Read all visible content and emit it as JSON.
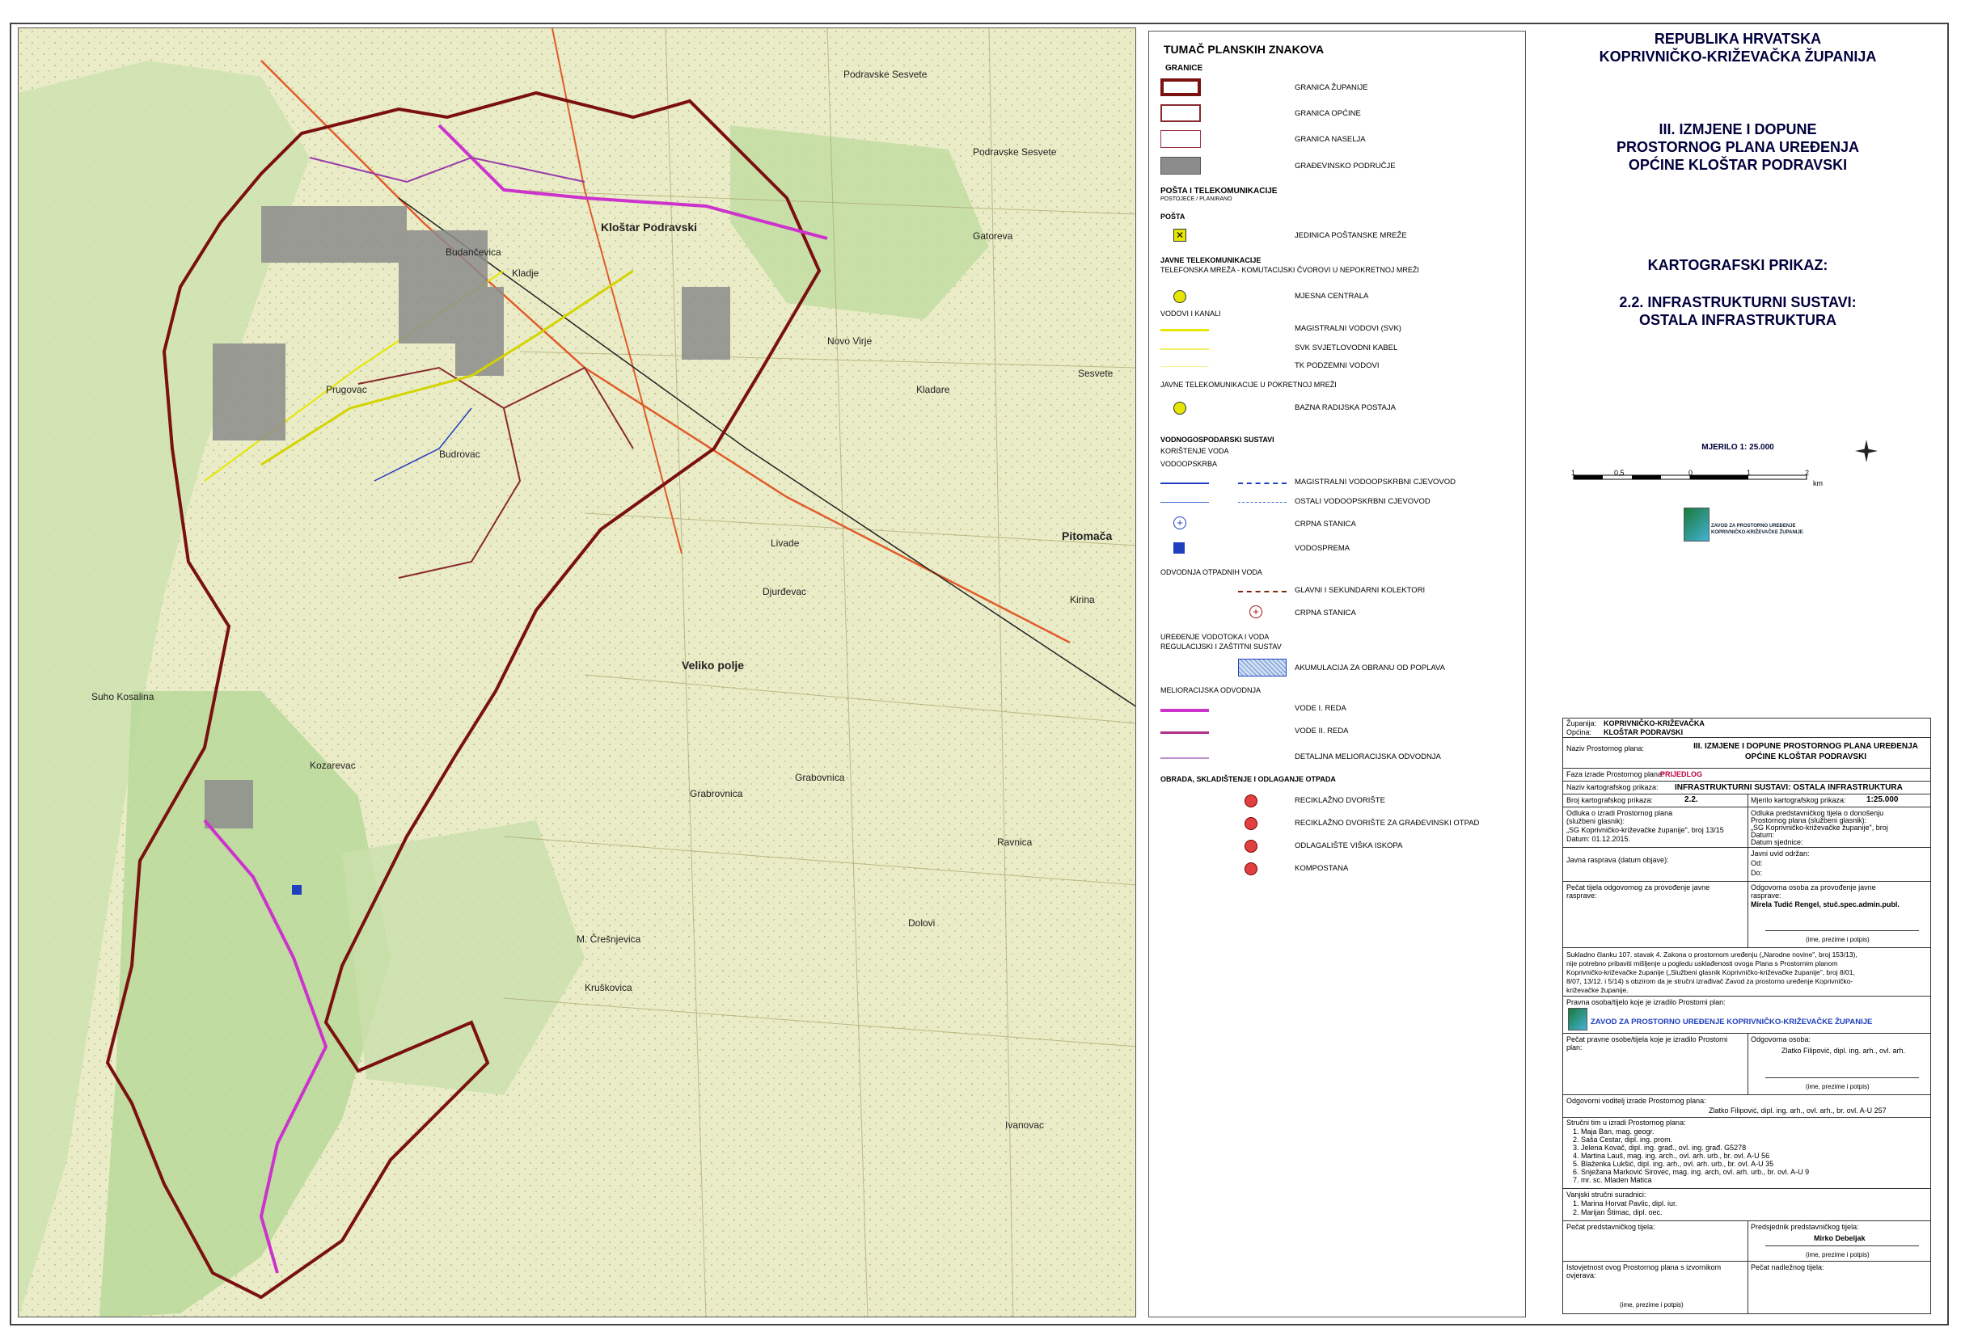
{
  "map": {
    "labels": [
      "Podravske Sesvete",
      "Kloštar Podravski",
      "Budančevica",
      "Prugovac",
      "Kozarevac",
      "Podravske Sesvete",
      "Kladare",
      "Pitomača",
      "Kladje",
      "Veliko polje",
      "Novo Virje",
      "Grabovnica",
      "Grabrovnica",
      "Budrovac",
      "Suho Kosalina",
      "M. Črešnjevica",
      "Kruškovica",
      "Ivanovac",
      "Sesvete",
      "Ravnica",
      "Livade",
      "Djurđevac",
      "Gatoreva",
      "Kirina",
      "Dolovi"
    ],
    "colors": {
      "county_border": "#7a1010",
      "municipality_border": "#8a2a30",
      "settlement_border": "#a03040",
      "ditch_first": "#cc33cc",
      "ditch_second": "#9a3aaa",
      "svk": "#e6e600",
      "water": "#1f3fbf",
      "built_area": "#8c8c8c"
    }
  },
  "legend": {
    "title": "TUMAČ PLANSKIH ZNAKOVA",
    "granice": {
      "heading": "GRANICE",
      "items": [
        "GRANICA ŽUPANIJE",
        "GRANICA OPĆINE",
        "GRANICA NASELJA",
        "GRAĐEVINSKO PODRUČJE"
      ]
    },
    "posta": {
      "heading": "POŠTA I TELEKOMUNIKACIJE",
      "sub": "POSTOJEĆE  /  PLANIRANO",
      "posta_h": "POŠTA",
      "jedinica": "JEDINICA POŠTANSKE MREŽE",
      "javne_h": "JAVNE TELEKOMUNIKACIJE",
      "tel_h": "TELEFONSKA MREŽA - KOMUTACIJSKI ČVOROVI U NEPOKRETNOJ MREŽI",
      "centrala": "MJESNA CENTRALA",
      "vodovi_h": "VODOVI I KANALI",
      "svk": "MAGISTRALNI VODOVI (SVK)",
      "kabel": "SVK SVJETLOVODNI KABEL",
      "tk": "TK PODZEMNI VODOVI",
      "pokretna_h": "JAVNE TELEKOMUNIKACIJE U POKRETNOJ MREŽI",
      "bazna": "BAZNA RADIJSKA POSTAJA"
    },
    "vodno": {
      "heading": "VODNOGOSPODARSKI SUSTAVI",
      "kor": "KORIŠTENJE VODA",
      "opskrba": "VODOOPSKRBA",
      "magistralni": "MAGISTRALNI VODOOPSKRBNI CJEVOVOD",
      "ostali": "OSTALI VODOOPSKRBNI CJEVOVOD",
      "crpna": "CRPNA STANICA",
      "vodosprema": "VODOSPREMA",
      "odvodnja_h": "ODVODNJA OTPADNIH VODA",
      "kolektori": "GLAVNI I SEKUNDARNI KOLEKTORI",
      "crpna2": "CRPNA STANICA",
      "uredenje_h": "UREĐENJE VODOTOKA I VODA",
      "regul_h": "REGULACIJSKI I ZAŠTITNI SUSTAV",
      "akumulacija": "AKUMULACIJA ZA OBRANU OD POPLAVA",
      "melior_h": "MELIORACIJSKA ODVODNJA",
      "vode1": "VODE I. REDA",
      "vode2": "VODE II. REDA",
      "detaljna": "DETALJNA MELIORACIJSKA ODVODNJA"
    },
    "otpad": {
      "heading": "OBRADA, SKLADIŠTENJE I ODLAGANJE OTPADA",
      "items": [
        "RECIKLAŽNO DVORIŠTE",
        "RECIKLAŽNO DVORIŠTE ZA GRAĐEVINSKI OTPAD",
        "ODLAGALIŠTE VIŠKA ISKOPA",
        "KOMPOSTANA"
      ]
    }
  },
  "titles": {
    "republic": "REPUBLIKA HRVATSKA",
    "county": "KOPRIVNIČKO-KRIŽEVAČKA ŽUPANIJA",
    "plan1": "III. IZMJENE I DOPUNE",
    "plan2": "PROSTORNOG PLANA UREĐENJA",
    "plan3": "OPĆINE KLOŠTAR PODRAVSKI",
    "kart": "KARTOGRAFSKI PRIKAZ:",
    "sub1": "2.2. INFRASTRUKTURNI SUSTAVI:",
    "sub2": "OSTALA INFRASTRUKTURA",
    "scale": "MJERILO 1: 25.000",
    "scale_ticks": [
      "1",
      "0,5",
      "0",
      "1",
      "2"
    ],
    "scale_unit": "km",
    "logo1": "ZAVOD ZA PROSTORNO UREĐENJE",
    "logo2": "KOPRIVNIČKO-KRIŽEVAČKE ŽUPANIJE"
  },
  "stamp": {
    "zupanija_k": "Županija:",
    "zupanija_v": "KOPRIVNIČKO-KRIŽEVAČKA",
    "opcina_k": "Općina:",
    "opcina_v": "KLOŠTAR PODRAVSKI",
    "naziv_k": "Naziv Prostornog plana:",
    "naziv_v1": "III. IZMJENE I DOPUNE PROSTORNOG PLANA UREĐENJA",
    "naziv_v2": "OPĆINE KLOŠTAR PODRAVSKI",
    "faza_k": "Faza izrade Prostornog plana:",
    "faza_v": "PRIJEDLOG",
    "nazivk_k": "Naziv kartografskog prikaza:",
    "nazivk_v": "INFRASTRUKTURNI SUSTAVI: OSTALA INFRASTRUKTURA",
    "broj_k": "Broj kartografskog prikaza:",
    "broj_v": "2.2.",
    "mjerilo_k": "Mjerilo kartografskog prikaza:",
    "mjerilo_v": "1:25.000",
    "odluka_l": [
      "Odluka o izradi Prostornog plana",
      "(službeni glasnik):",
      "„SG Koprivničko-križevačke županije\", broj 13/15",
      "Datum: 01.12.2015."
    ],
    "odluka_r": [
      "Odluka predstavničkog tijela o donošenju",
      "Prostornog plana (službeni glasnik):",
      "„SG Koprivničko-križevačke županije\", broj",
      "Datum:",
      "Datum sjednice:"
    ],
    "javna_l": "Javna rasprava (datum objave):",
    "javna_r": [
      "Javni uvid održan:",
      "Od:",
      "Do:"
    ],
    "pecat_l": [
      "Pečat tijela odgovornog za provođenje javne",
      "rasprave:"
    ],
    "pecat_r1": [
      "Odgovorna osoba za provođenje javne",
      "rasprave:"
    ],
    "pecat_r2": "Mirela Tudić Rengel, stuč.spec.admin.publ.",
    "ime1": "(ime, prezime i potpis)",
    "sukladno": [
      "Sukladno članku 107. stavak 4. Zakona o prostornom uređenju („Narodne novine\", broj 153/13),",
      "nije potrebno pribaviti mišljenje u pogledu usklađenosti ovoga Plana s Prostornim planom",
      "Koprivničko-križevačke županije („Službeni glasnik Koprivničko-križevačke županije\", broj 8/01,",
      "8/07, 13/12. i 5/14) s obzirom da je stručni izrađivač Zavod za prostorno uređenje Koprivničko-",
      "križevačke županije."
    ],
    "pravna_k": "Pravna osoba/tijelo koje je izradilo Prostorni plan:",
    "pravna_v": "ZAVOD ZA PROSTORNO UREĐENJE KOPRIVNIČKO-KRIŽEVAČKE ŽUPANIJE",
    "pecatp_l": [
      "Pečat pravne osobe/tijela koje je izradilo Prostorni",
      "plan:"
    ],
    "odg_k": "Odgovorna osoba:",
    "odg_v": "Zlatko Filipović, dipl. ing. arh., ovl. arh.",
    "ime2": "(ime, prezime i potpis)",
    "vod_k": "Odgovorni voditelj izrade Prostornog plana:",
    "vod_v": "Zlatko Filipović, dipl. ing. arh., ovl. arh., br. ovl. A-U 257",
    "tim_k": "Stručni tim u izradi Prostornog plana:",
    "tim": [
      "1.   Maja Ban, mag. geogr.",
      "2.   Saša Cestar, dipl. ing. prom.",
      "3.   Jelena Kovač, dipl. ing. građ., ovl. ing. građ. G5278",
      "4.   Martina Lauš, mag. ing. arch., ovl. arh. urb., br. ovl. A-U 56",
      "5.   Blaženka Lukšić, dipl. ing. arh., ovl. arh. urb., br. ovl. A-U 35",
      "6.   Snježana Marković Sirovec, mag. ing. arch, ovl. arh. urb., br. ovl. A-U 9",
      "7.   mr. sc. Mladen Matica"
    ],
    "van_k": "Vanjski stručni suradnici:",
    "van": [
      "1.   Marina Horvat Pavlic, dipl. iur.",
      "2.   Marijan Štimac, dipl. oec."
    ],
    "pecpr_k": "Pečat predstavničkog tijela:",
    "pred_k": "Predsjednik predstavničkog tijela:",
    "pred_v": "Mirko Debeljak",
    "ime3": "(ime, prezime i potpis)",
    "istov_k": [
      "Istovjetnost ovog Prostornog plana s izvornikom",
      "ovjerava:"
    ],
    "ime4": "(ime, prezime i potpis)",
    "pecnad_k": "Pečat nadležnog tijela:"
  }
}
